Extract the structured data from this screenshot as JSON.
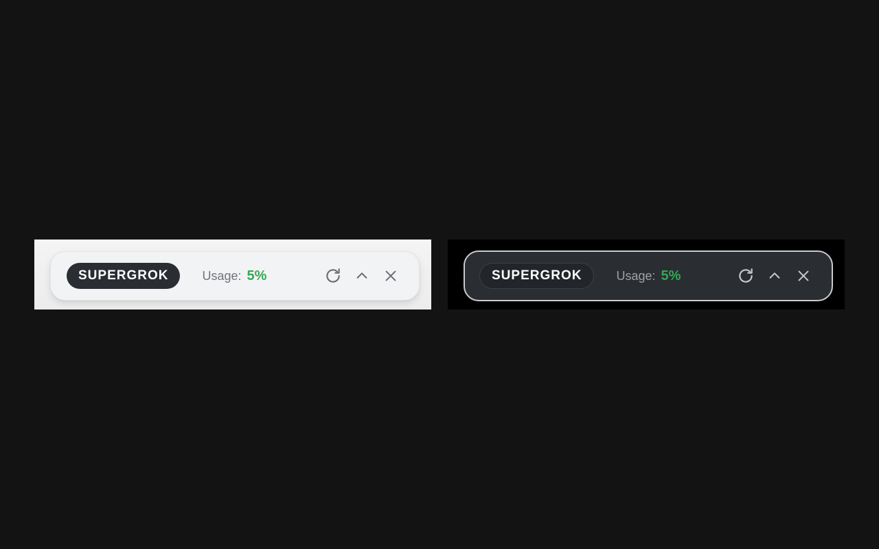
{
  "widgets": [
    {
      "theme": "light",
      "badge_label": "SUPERGROK",
      "usage_label": "Usage:",
      "usage_value": "5%",
      "icons": [
        "refresh-icon",
        "chevron-up-icon",
        "close-icon"
      ]
    },
    {
      "theme": "dark",
      "badge_label": "SUPERGROK",
      "usage_label": "Usage:",
      "usage_value": "5%",
      "icons": [
        "refresh-icon",
        "chevron-up-icon",
        "close-icon"
      ]
    }
  ],
  "colors": {
    "page_background": "#131313",
    "usage_accent": "#34a853",
    "light_bar": "#f2f3f5",
    "dark_bar": "#2a2e32",
    "badge": "#2a2e33"
  }
}
